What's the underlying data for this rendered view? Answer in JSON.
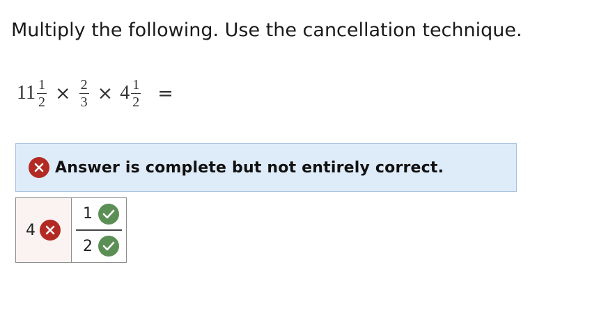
{
  "instruction": "Multiply the following. Use the cancellation technique.",
  "problem": {
    "term1": {
      "whole": "11",
      "num": "1",
      "den": "2"
    },
    "term2": {
      "num": "2",
      "den": "3"
    },
    "term3": {
      "whole": "4",
      "num": "1",
      "den": "2"
    },
    "times_symbol": "×",
    "equals_symbol": "="
  },
  "feedback": {
    "status_text": "Answer is complete but not entirely correct.",
    "status_icon": "x-circle-icon",
    "colors": {
      "wrong": "#b22a23",
      "correct": "#5b8f55",
      "panel_bg": "#deebf8"
    }
  },
  "answer": {
    "whole": {
      "value": "4",
      "status": "incorrect",
      "icon": "x-circle-icon"
    },
    "numerator": {
      "value": "1",
      "status": "correct",
      "icon": "check-circle-icon"
    },
    "denominator": {
      "value": "2",
      "status": "correct",
      "icon": "check-circle-icon"
    }
  }
}
